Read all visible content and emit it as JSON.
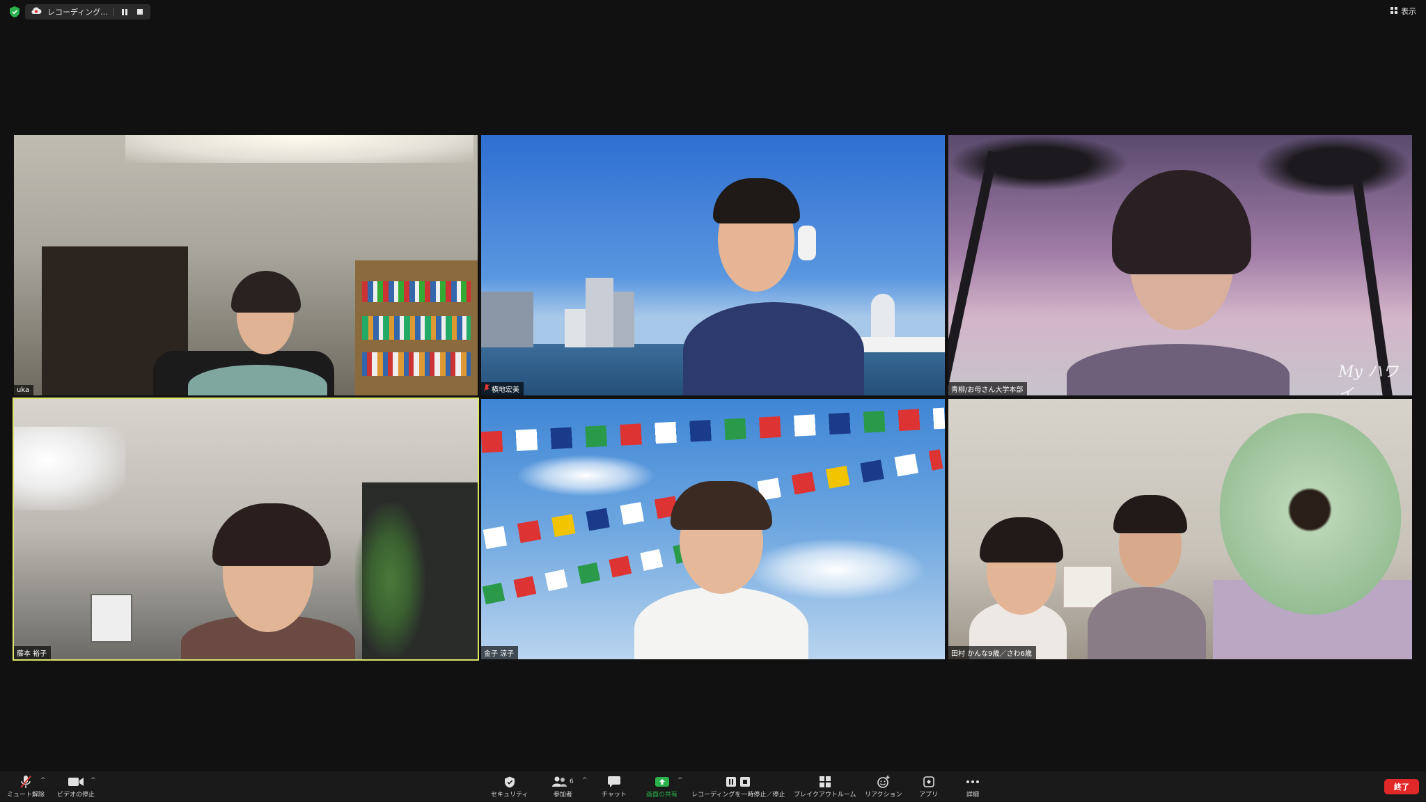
{
  "top_bar": {
    "recording_label": "レコーディング...",
    "view_label": "表示"
  },
  "participants": [
    {
      "name": "uka",
      "muted": false,
      "active_speaker": false
    },
    {
      "name": "横地宏美",
      "muted": true,
      "active_speaker": false
    },
    {
      "name": "青柳/お母さん大学本部",
      "muted": false,
      "active_speaker": false
    },
    {
      "name": "藤本 裕子",
      "muted": false,
      "active_speaker": true
    },
    {
      "name": "金子 涼子",
      "muted": false,
      "active_speaker": false
    },
    {
      "name": "田村 かんな9歳／さわ6歳",
      "muted": false,
      "active_speaker": false
    }
  ],
  "tile_overlays": {
    "watermark": "My ハワイ"
  },
  "toolbar": {
    "mute_label": "ミュート解除",
    "video_label": "ビデオの停止",
    "security_label": "セキュリティ",
    "participants_label": "参加者",
    "participants_count": "6",
    "chat_label": "チャット",
    "share_label": "画面の共有",
    "recording_label": "レコーディングを一時停止／停止",
    "breakout_label": "ブレイクアウトルーム",
    "reaction_label": "リアクション",
    "apps_label": "アプリ",
    "more_label": "詳細",
    "end_label": "終了"
  },
  "colors": {
    "background": "#111111",
    "active_border": "#dfe56a",
    "share_green": "#2bb24c",
    "end_red": "#e02828",
    "shield_green": "#2bb24c"
  }
}
